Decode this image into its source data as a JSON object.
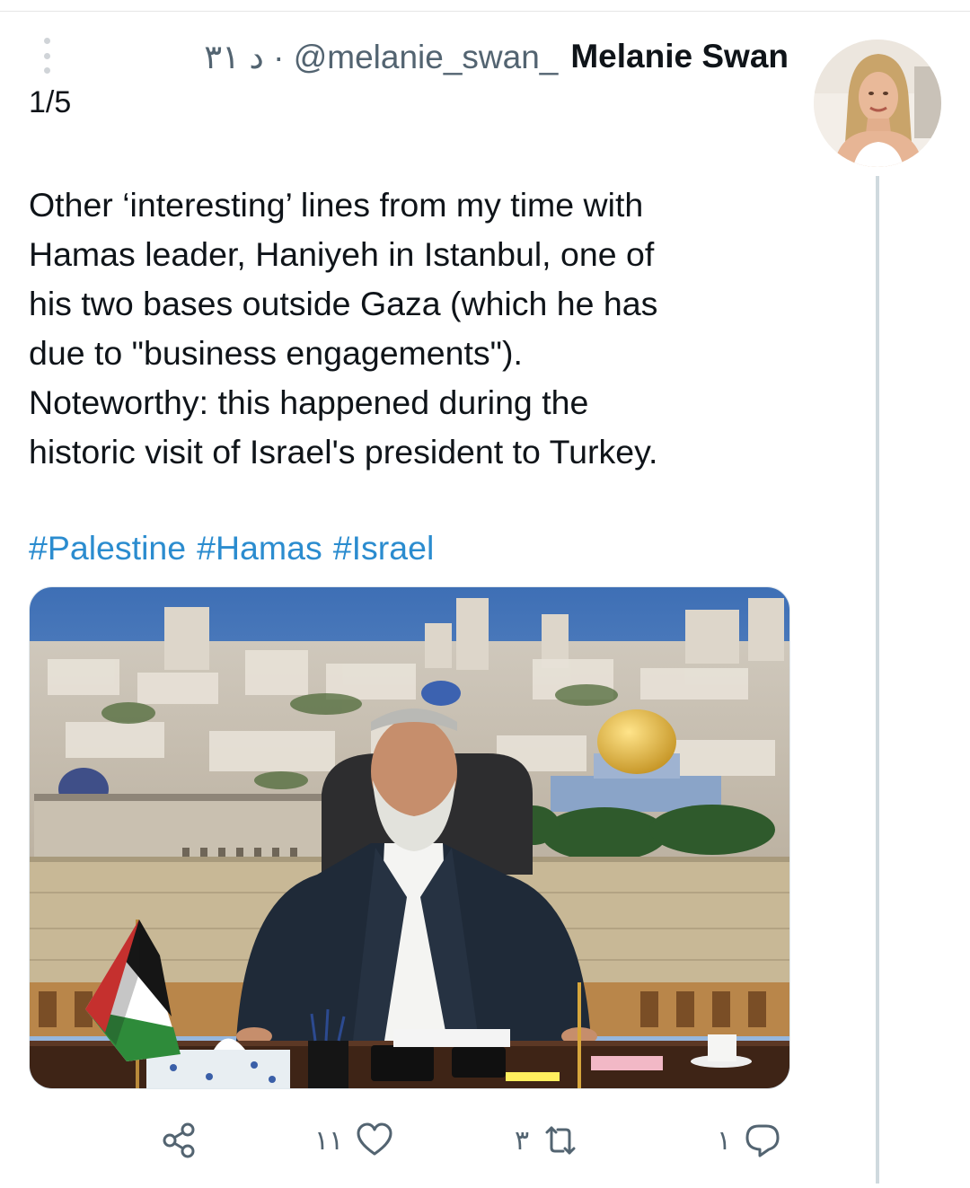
{
  "tweet": {
    "display_name": "Melanie Swan",
    "handle_meta": "د ٣١ · @melanie_swan_",
    "thread_count": "1/5",
    "lines": [
      "Other ‘interesting’ lines from my time with",
      "Hamas leader, Haniyeh in Istanbul, one of",
      "his two bases outside Gaza (which he has",
      "due to \"business engagements\").",
      "Noteworthy: this happened during the",
      "historic visit of Israel's president to Turkey."
    ],
    "hashtags": [
      "#Palestine",
      "#Hamas",
      "#Israel"
    ]
  },
  "actions": {
    "reply_count": "١",
    "retweet_count": "٣",
    "like_count": "١١"
  },
  "colors": {
    "link": "#2b8ccf",
    "secondary_text": "#536471",
    "icon": "#536471",
    "thread_line": "#cfd9de"
  },
  "icons": {
    "more": "vertical-dots-icon",
    "share": "share-icon",
    "like": "heart-icon",
    "retweet": "retweet-icon",
    "reply": "reply-icon"
  }
}
